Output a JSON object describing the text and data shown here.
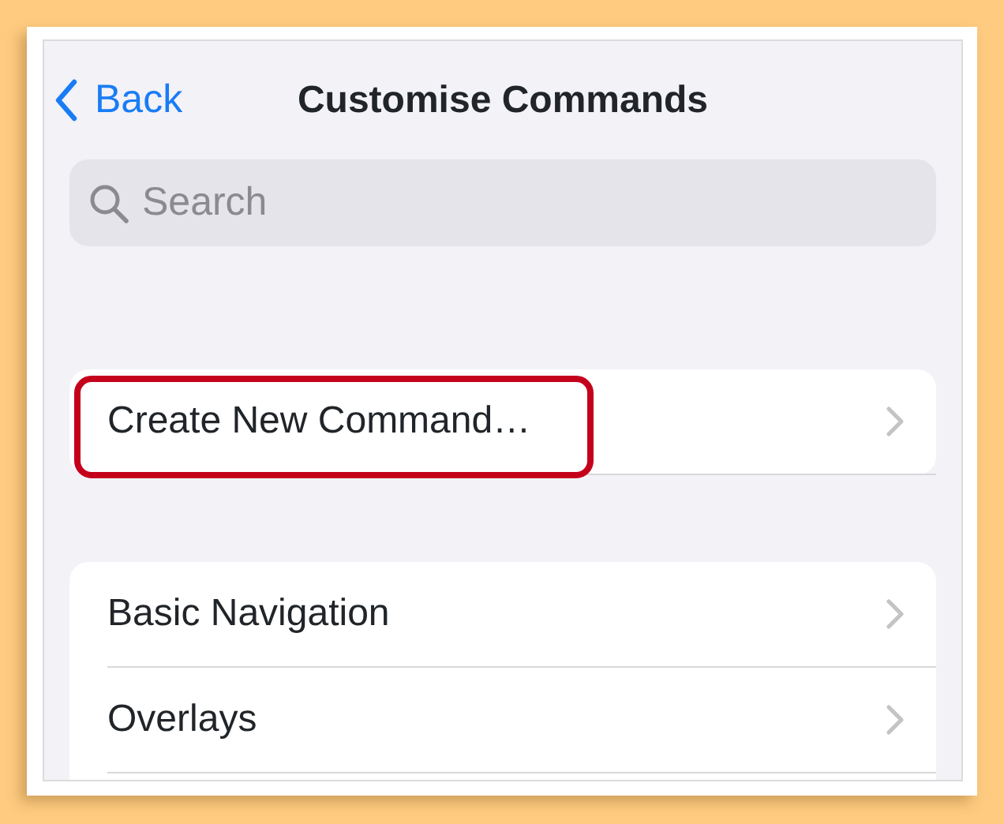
{
  "nav": {
    "back_label": "Back",
    "title": "Customise Commands"
  },
  "search": {
    "placeholder": "Search"
  },
  "groups": [
    {
      "items": [
        {
          "label": "Create New Command…",
          "highlighted": true
        }
      ]
    },
    {
      "items": [
        {
          "label": "Basic Navigation",
          "highlighted": false
        },
        {
          "label": "Overlays",
          "highlighted": false
        }
      ]
    }
  ]
}
